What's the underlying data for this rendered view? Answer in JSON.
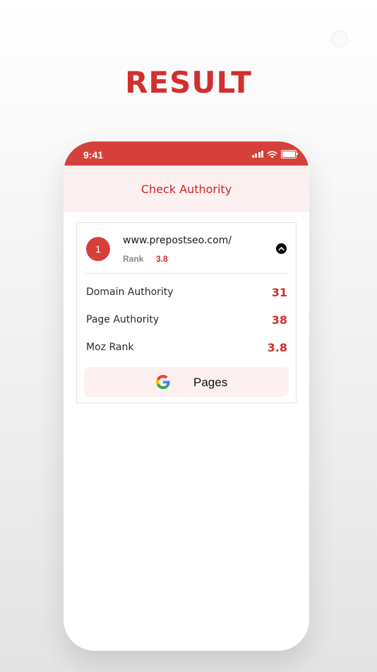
{
  "headline": "RESULT",
  "status_bar": {
    "time": "9:41",
    "icons": [
      "signal-icon",
      "wifi-icon",
      "battery-icon"
    ]
  },
  "app": {
    "title": "Check Authority"
  },
  "result": {
    "index": "1",
    "url": "www.prepostseo.com/",
    "rank_label": "Rank",
    "rank_value": "3.8",
    "toggle_icon": "chevron-up-icon",
    "metrics": [
      {
        "label": "Domain Authority",
        "value": "31"
      },
      {
        "label": "Page Authority",
        "value": "38"
      },
      {
        "label": "Moz Rank",
        "value": "3.8"
      }
    ],
    "pages_button": {
      "icon": "google-icon",
      "label": "Pages"
    }
  },
  "colors": {
    "accent": "#d32f2f",
    "status_bar": "#d6403a",
    "header_bg": "#fdf0f0"
  }
}
